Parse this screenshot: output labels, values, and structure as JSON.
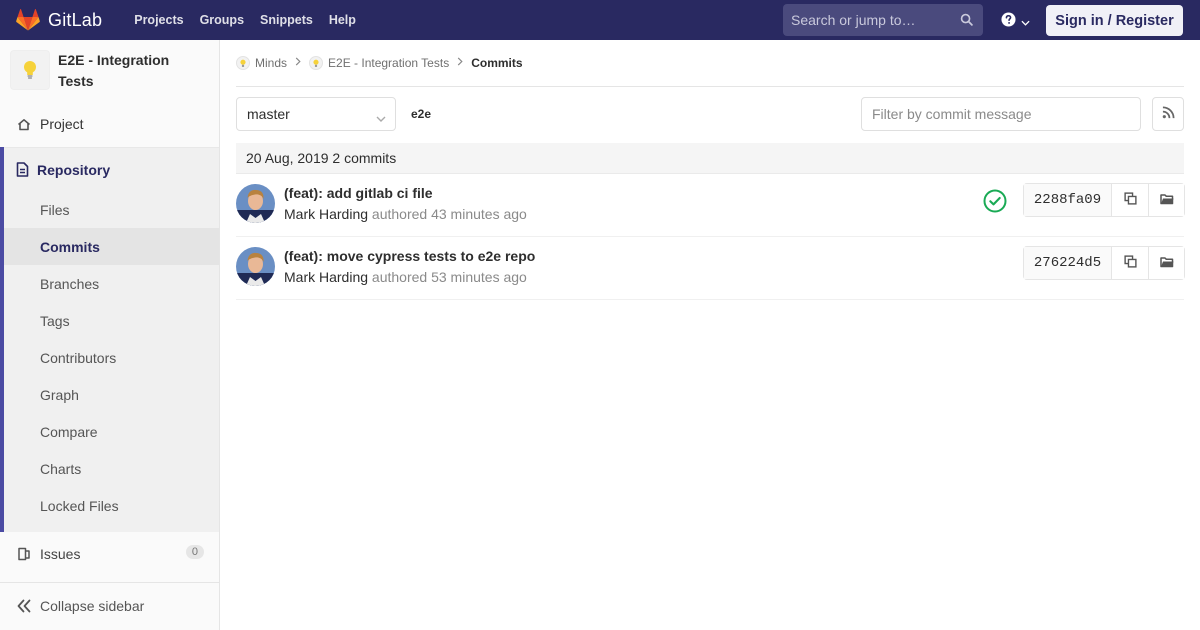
{
  "navbar": {
    "brand": "GitLab",
    "links": [
      "Projects",
      "Groups",
      "Snippets",
      "Help"
    ],
    "search_placeholder": "Search or jump to…",
    "sign_in": "Sign in / Register",
    "bg_color": "#292961"
  },
  "sidebar": {
    "project_name": "E2E - Integration Tests",
    "project_label": "Project",
    "repository_label": "Repository",
    "repository_items": [
      {
        "label": "Files",
        "active": false
      },
      {
        "label": "Commits",
        "active": true
      },
      {
        "label": "Branches",
        "active": false
      },
      {
        "label": "Tags",
        "active": false
      },
      {
        "label": "Contributors",
        "active": false
      },
      {
        "label": "Graph",
        "active": false
      },
      {
        "label": "Compare",
        "active": false
      },
      {
        "label": "Charts",
        "active": false
      },
      {
        "label": "Locked Files",
        "active": false
      }
    ],
    "issues_label": "Issues",
    "issues_count": "0",
    "collapse_label": "Collapse sidebar"
  },
  "breadcrumb": [
    "Minds",
    "E2E - Integration Tests",
    "Commits"
  ],
  "toolbar": {
    "branch": "master",
    "path": "e2e",
    "filter_placeholder": "Filter by commit message"
  },
  "commit_day": "20 Aug, 2019 2 commits",
  "commits": [
    {
      "title": "(feat): add gitlab ci file",
      "author": "Mark Harding",
      "authored": "authored 43 minutes ago",
      "sha": "2288fa09",
      "pipeline": "passed"
    },
    {
      "title": "(feat): move cypress tests to e2e repo",
      "author": "Mark Harding",
      "authored": "authored 53 minutes ago",
      "sha": "276224d5",
      "pipeline": ""
    }
  ],
  "colors": {
    "accent": "#292961",
    "success": "#1aaa55",
    "active_border": "#4b4ba3"
  }
}
